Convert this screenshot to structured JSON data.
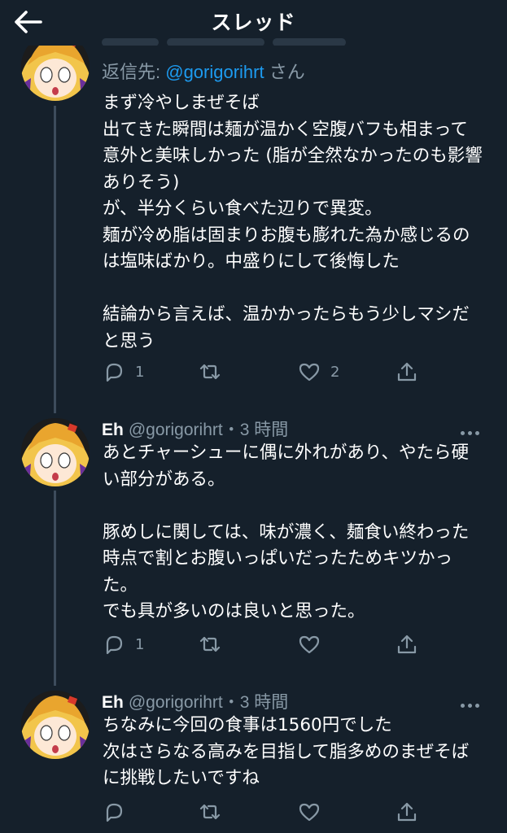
{
  "header": {
    "title": "スレッド"
  },
  "tweets": [
    {
      "reply_prefix": "返信先: ",
      "reply_mention": "@gorigorihrt",
      "reply_suffix": " さん",
      "text": "まず冷やしまぜそば\n出てきた瞬間は麺が温かく空腹バフも相まって意外と美味しかった (脂が全然なかったのも影響ありそう)\nが、半分くらい食べた辺りで異変。\n麺が冷め脂は固まりお腹も膨れた為か感じるのは塩味ばかり。中盛りにして後悔した\n\n結論から言えば、温かかったらもう少しマシだと思う",
      "reply_count": "1",
      "like_count": "2"
    },
    {
      "name": "Eh",
      "handle": "@gorigorihrt",
      "time": "・3 時間",
      "text": "あとチャーシューに偶に外れがあり、やたら硬い部分がある。\n\n豚めしに関しては、味が濃く、麺食い終わった時点で割とお腹いっぱいだったためキツかった。\nでも具が多いのは良いと思った。",
      "reply_count": "1",
      "like_count": ""
    },
    {
      "name": "Eh",
      "handle": "@gorigorihrt",
      "time": "・3 時間",
      "text": "ちなみに今回の食事は1560円でした\n次はさらなる高みを目指して脂多めのまぜそばに挑戦したいですね",
      "reply_count": "",
      "like_count": ""
    }
  ],
  "icons": {
    "back": "arrow-left-icon",
    "reply": "reply-icon",
    "retweet": "retweet-icon",
    "like": "heart-icon",
    "share": "share-icon",
    "more": "more-icon"
  },
  "colors": {
    "background": "#15202b",
    "secondary_text": "#8899a6",
    "link": "#1d9bf0",
    "thread_line": "#3d4c5c"
  }
}
